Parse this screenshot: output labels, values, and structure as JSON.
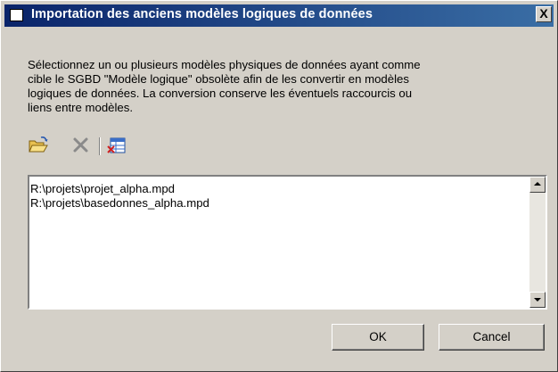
{
  "window": {
    "title": "Importation des anciens modèles logiques de données",
    "close_label": "X"
  },
  "description": "Sélectionnez un ou plusieurs modèles physiques de données ayant comme\ncible le SGBD \"Modèle logique\" obsolète afin de les convertir en modèles\nlogiques de données. La conversion conserve les éventuels raccourcis ou\nliens entre modèles.",
  "toolbar": {
    "icons": [
      "open-folder-icon",
      "delete-x-icon",
      "clear-list-icon"
    ]
  },
  "files": [
    "R:\\projets\\projet_alpha.mpd",
    "R:\\projets\\basedonnes_alpha.mpd"
  ],
  "buttons": {
    "ok": "OK",
    "cancel": "Cancel"
  },
  "colors": {
    "title_gradient_start": "#0a246a",
    "title_gradient_end": "#3a6ea5",
    "dialog_bg": "#d4d0c8"
  }
}
